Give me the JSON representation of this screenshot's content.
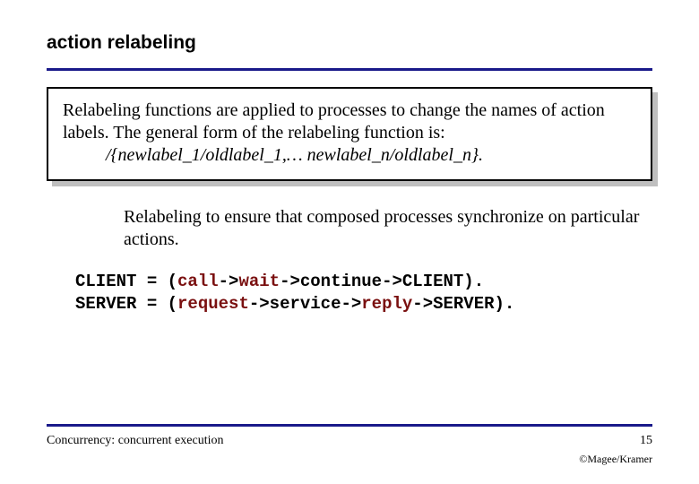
{
  "title": "action relabeling",
  "box": {
    "para": "Relabeling functions are applied to processes to change the names of action labels. The general form of the relabeling function is:",
    "formula": "/{newlabel_1/oldlabel_1,… newlabel_n/oldlabel_n}."
  },
  "mid": "Relabeling to ensure that composed processes synchronize on particular actions.",
  "code": {
    "client_lhs": "CLIENT = (",
    "client_call": "call",
    "client_arrow1": "->",
    "client_wait": "wait",
    "client_rest": "->continue->CLIENT).",
    "server_lhs": "SERVER = (",
    "server_request": "request",
    "server_arrow1": "->service->",
    "server_reply": "reply",
    "server_rest": "->SERVER)."
  },
  "footer": {
    "left": "Concurrency: concurrent execution",
    "pageno": "15",
    "credit": "©Magee/Kramer"
  }
}
